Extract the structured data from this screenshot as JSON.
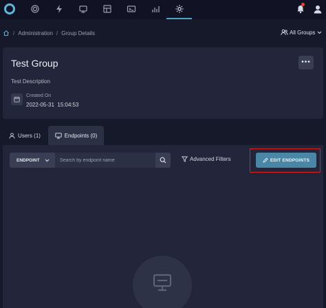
{
  "nav": {
    "icons": [
      "app-logo",
      "target-icon",
      "lightning-icon",
      "monitor-icon",
      "dashboard-icon",
      "terminal-icon",
      "chart-icon",
      "gear-icon",
      "bell-icon",
      "user-avatar-icon"
    ],
    "active": "gear-icon"
  },
  "breadcrumb": {
    "home_icon": "home-icon",
    "items": [
      "Administration",
      "Group Details"
    ],
    "separator": "/"
  },
  "groups_selector": {
    "label": "All Groups"
  },
  "group": {
    "title": "Test Group",
    "description": "Test Description",
    "created_label": "Created On",
    "created_value": "2022-05-31  15:04:53",
    "more_label": "•••"
  },
  "tabs": [
    {
      "label": "Users (1)",
      "icon": "user-icon",
      "active": false
    },
    {
      "label": "Endpoints (0)",
      "icon": "monitor-icon",
      "active": true
    }
  ],
  "endpoints": {
    "filter_field": "ENDPOINT",
    "search_placeholder": "Search by endpoint name",
    "advanced_filters_label": "Advanced Filters",
    "edit_button_label": "EDIT ENDPOINTS",
    "empty_icon": "monitor-icon"
  },
  "colors": {
    "background": "#16192a",
    "card": "#23263a",
    "accent": "#4a87a7",
    "highlight_outline": "#e02020",
    "notification_dot": "#e8433a"
  }
}
